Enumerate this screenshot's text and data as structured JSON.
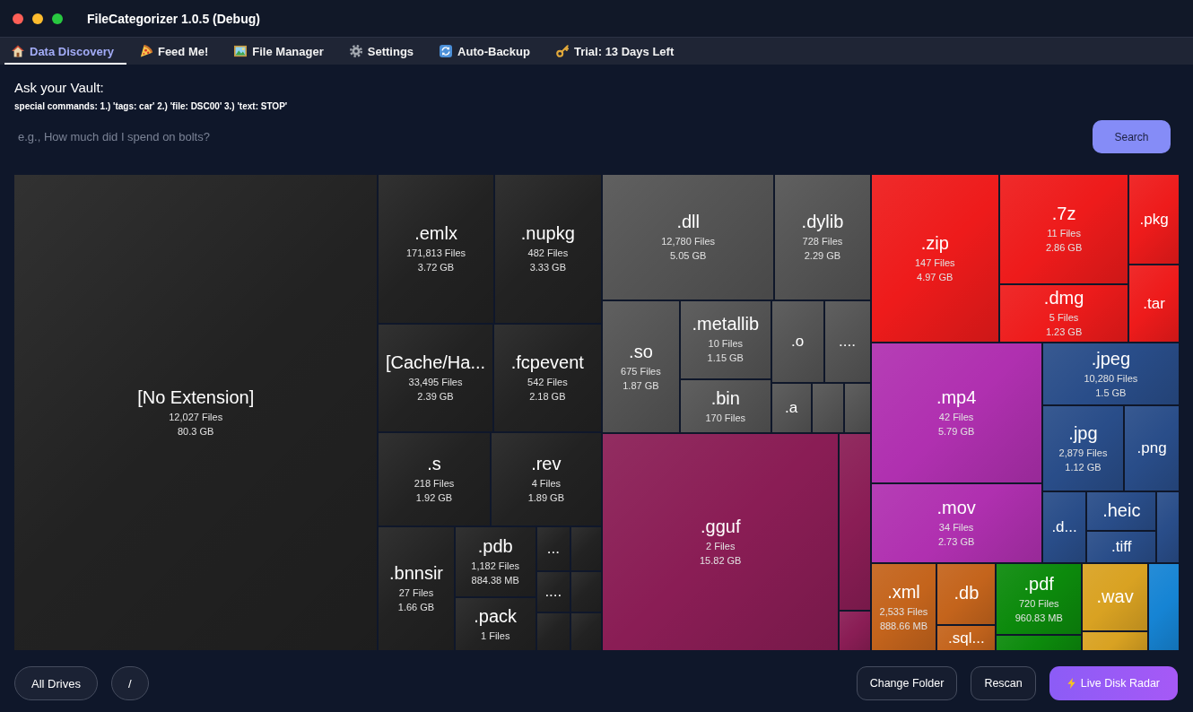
{
  "window": {
    "title": "FileCategorizer 1.0.5 (Debug)"
  },
  "tabs": [
    {
      "label": "Data Discovery",
      "selected": true
    },
    {
      "label": "Feed Me!",
      "selected": false
    },
    {
      "label": "File Manager",
      "selected": false
    },
    {
      "label": "Settings",
      "selected": false
    },
    {
      "label": "Auto-Backup",
      "selected": false
    },
    {
      "label": "Trial: 13 Days Left",
      "selected": false
    }
  ],
  "query": {
    "heading": "Ask your Vault:",
    "hint": "special commands: 1.) 'tags: car' 2.) 'file: DSC00' 3.) 'text: STOP'",
    "placeholder": "e.g., How much did I spend on bolts?",
    "button": "Search"
  },
  "treemap": {
    "tiles": [
      {
        "label": "[No Extension]",
        "files": "12,027 Files",
        "size": "80.3 GB",
        "color": "#222222"
      },
      {
        "label": ".emlx",
        "files": "171,813 Files",
        "size": "3.72 GB",
        "color": "#222222"
      },
      {
        "label": ".nupkg",
        "files": "482 Files",
        "size": "3.33 GB",
        "color": "#222222"
      },
      {
        "label": "[Cache/Ha...",
        "files": "33,495 Files",
        "size": "2.39 GB",
        "color": "#222222"
      },
      {
        "label": ".fcpevent",
        "files": "542 Files",
        "size": "2.18 GB",
        "color": "#222222"
      },
      {
        "label": ".s",
        "files": "218 Files",
        "size": "1.92 GB",
        "color": "#222222"
      },
      {
        "label": ".rev",
        "files": "4 Files",
        "size": "1.89 GB",
        "color": "#222222"
      },
      {
        "label": ".bnnsir",
        "files": "27 Files",
        "size": "1.66 GB",
        "color": "#222222"
      },
      {
        "label": ".pdb",
        "files": "1,182 Files",
        "size": "884.38 MB",
        "color": "#222222"
      },
      {
        "label": ".pack",
        "files": "1 Files",
        "color": "#222222"
      },
      {
        "label": "...",
        "color": "#222222"
      },
      {
        "color": "#222222"
      },
      {
        "label": "....",
        "color": "#222222"
      },
      {
        "color": "#222222"
      },
      {
        "color": "#222222"
      },
      {
        "color": "#222222"
      },
      {
        "label": ".dll",
        "files": "12,780 Files",
        "size": "5.05 GB",
        "color": "#545454"
      },
      {
        "label": ".dylib",
        "files": "728 Files",
        "size": "2.29 GB",
        "color": "#545454"
      },
      {
        "label": ".so",
        "files": "675 Files",
        "size": "1.87 GB",
        "color": "#545454"
      },
      {
        "label": ".metallib",
        "files": "10 Files",
        "size": "1.15 GB",
        "color": "#545454"
      },
      {
        "label": ".bin",
        "files": "170 Files",
        "color": "#545454"
      },
      {
        "label": ".o",
        "color": "#545454"
      },
      {
        "label": "....",
        "color": "#545454"
      },
      {
        "label": ".a",
        "color": "#545454"
      },
      {
        "color": "#545454"
      },
      {
        "color": "#545454"
      },
      {
        "label": ".gguf",
        "files": "2 Files",
        "size": "15.82 GB",
        "color": "#8a1d55"
      },
      {
        "color": "#8a1d55"
      },
      {
        "color": "#8a1d55"
      },
      {
        "label": ".zip",
        "files": "147 Files",
        "size": "4.97 GB",
        "color": "#ee1b1b"
      },
      {
        "label": ".7z",
        "files": "11 Files",
        "size": "2.86 GB",
        "color": "#ee1b1b"
      },
      {
        "label": ".dmg",
        "files": "5 Files",
        "size": "1.23 GB",
        "color": "#ee1b1b"
      },
      {
        "label": ".pkg",
        "color": "#ee1b1b"
      },
      {
        "label": ".tar",
        "color": "#ee1b1b"
      },
      {
        "label": ".mp4",
        "files": "42 Files",
        "size": "5.79 GB",
        "color": "#b030b0"
      },
      {
        "label": ".mov",
        "files": "34 Files",
        "size": "2.73 GB",
        "color": "#b030b0"
      },
      {
        "label": ".jpeg",
        "files": "10,280 Files",
        "size": "1.5 GB",
        "color": "#294d89"
      },
      {
        "label": ".jpg",
        "files": "2,879 Files",
        "size": "1.12 GB",
        "color": "#294d89"
      },
      {
        "label": ".png",
        "color": "#294d89"
      },
      {
        "label": ".d...",
        "color": "#294d89"
      },
      {
        "label": ".heic",
        "color": "#294d89"
      },
      {
        "label": ".tiff",
        "color": "#294d89"
      },
      {
        "color": "#294d89"
      },
      {
        "label": ".xml",
        "files": "2,533 Files",
        "size": "888.66 MB",
        "color": "#c4641c"
      },
      {
        "label": ".db",
        "color": "#c4641c"
      },
      {
        "label": ".sql...",
        "color": "#c4641c"
      },
      {
        "label": ".pdf",
        "files": "720 Files",
        "size": "960.83 MB",
        "color": "#0c8a0c"
      },
      {
        "color": "#0c8a0c"
      },
      {
        "label": ".wav",
        "color": "#d9a222"
      },
      {
        "color": "#d9a222"
      },
      {
        "color": "#1684d4"
      }
    ]
  },
  "footer": {
    "locations": [
      "All Drives",
      "/"
    ],
    "actions": [
      {
        "label": "Change Folder",
        "kind": "outline"
      },
      {
        "label": "Rescan",
        "kind": "outline"
      },
      {
        "label": "Live Disk Radar",
        "kind": "primary"
      }
    ]
  }
}
